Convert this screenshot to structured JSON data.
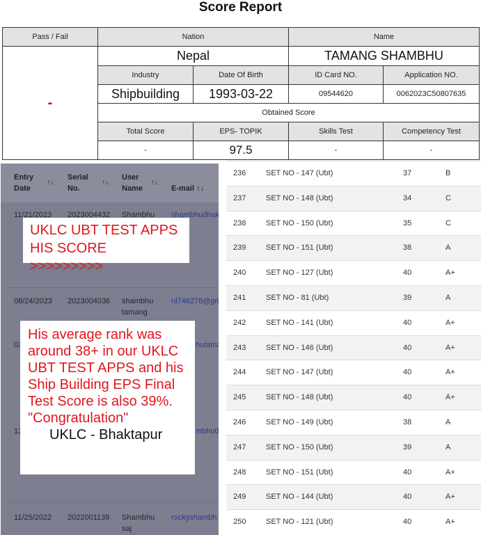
{
  "report": {
    "title": "Score Report",
    "headers": {
      "pass_fail": "Pass / Fail",
      "nation": "Nation",
      "name": "Name",
      "industry": "Industry",
      "dob": "Date Of Birth",
      "id_card": "ID Card NO.",
      "application": "Application NO.",
      "obtained": "Obtained Score",
      "total": "Total Score",
      "eps": "EPS- TOPIK",
      "skills": "Skills Test",
      "competency": "Competency Test"
    },
    "values": {
      "pass_fail": "-",
      "nation": "Nepal",
      "name": "TAMANG SHAMBHU",
      "industry": "Shipbuilding",
      "dob": "1993-03-22",
      "id_card": "09544620",
      "application": "0062023C50807635",
      "total": "-",
      "eps": "97.5",
      "skills": "-",
      "competency": "-"
    }
  },
  "left_table": {
    "headers": {
      "entry_date": [
        "Entry",
        "Date"
      ],
      "serial_no": [
        "Serial",
        "No."
      ],
      "user_name": [
        "User",
        "Name"
      ],
      "email": "E-mail"
    },
    "sort_icon": "up-down-arrows",
    "rows": [
      {
        "date": "11/21/2023",
        "serial": "2023004432",
        "user": [
          "Shambhu",
          ""
        ],
        "email": "shambhudhak"
      },
      {
        "date": "08/24/2023",
        "serial": "2023004036",
        "user": [
          "shambhu",
          "tamang"
        ],
        "email": "nl746278@gm"
      },
      {
        "date": "03",
        "serial": "",
        "user": [
          "",
          ""
        ],
        "email": "hutama"
      },
      {
        "date": "12",
        "serial": "",
        "user": [
          "",
          ""
        ],
        "email": "mbhu01"
      },
      {
        "date": "11/25/2022",
        "serial": "2022001139",
        "user": [
          "Shambhu",
          "saj"
        ],
        "email": "rockyshambh"
      }
    ]
  },
  "right_list": [
    {
      "rank": "236",
      "set": "SET NO - 147 (Ubt)",
      "score": "37",
      "grade": "B"
    },
    {
      "rank": "237",
      "set": "SET NO - 148 (Ubt)",
      "score": "34",
      "grade": "C"
    },
    {
      "rank": "238",
      "set": "SET NO - 150 (Ubt)",
      "score": "35",
      "grade": "C"
    },
    {
      "rank": "239",
      "set": "SET NO - 151 (Ubt)",
      "score": "38",
      "grade": "A"
    },
    {
      "rank": "240",
      "set": "SET NO - 127 (Ubt)",
      "score": "40",
      "grade": "A+"
    },
    {
      "rank": "241",
      "set": "SET NO - 81 (Ubt)",
      "score": "39",
      "grade": "A"
    },
    {
      "rank": "242",
      "set": "SET NO - 141 (Ubt)",
      "score": "40",
      "grade": "A+"
    },
    {
      "rank": "243",
      "set": "SET NO - 146 (Ubt)",
      "score": "40",
      "grade": "A+"
    },
    {
      "rank": "244",
      "set": "SET NO - 147 (Ubt)",
      "score": "40",
      "grade": "A+"
    },
    {
      "rank": "245",
      "set": "SET NO - 148 (Ubt)",
      "score": "40",
      "grade": "A+"
    },
    {
      "rank": "246",
      "set": "SET NO - 149 (Ubt)",
      "score": "38",
      "grade": "A"
    },
    {
      "rank": "247",
      "set": "SET NO - 150 (Ubt)",
      "score": "39",
      "grade": "A"
    },
    {
      "rank": "248",
      "set": "SET NO - 151 (Ubt)",
      "score": "40",
      "grade": "A+"
    },
    {
      "rank": "249",
      "set": "SET NO - 144 (Ubt)",
      "score": "40",
      "grade": "A+"
    },
    {
      "rank": "250",
      "set": "SET NO - 121 (Ubt)",
      "score": "40",
      "grade": "A+"
    }
  ],
  "overlays": {
    "box1": [
      "UKLC UBT TEST APPS",
      "HIS SCORE >>>>>>>>>"
    ],
    "box2": [
      "His average rank was",
      "around 38+ in our UKLC",
      "UBT TEST APPS and his",
      "Ship Building EPS Final",
      "Test Score is also 39%.",
      "\"Congratulation\""
    ],
    "signature": "UKLC - Bhaktapur"
  },
  "colors": {
    "annotation_red": "#e0161c",
    "header_gray": "#e3e3e3",
    "panel_dim": "#7d7e8f"
  }
}
